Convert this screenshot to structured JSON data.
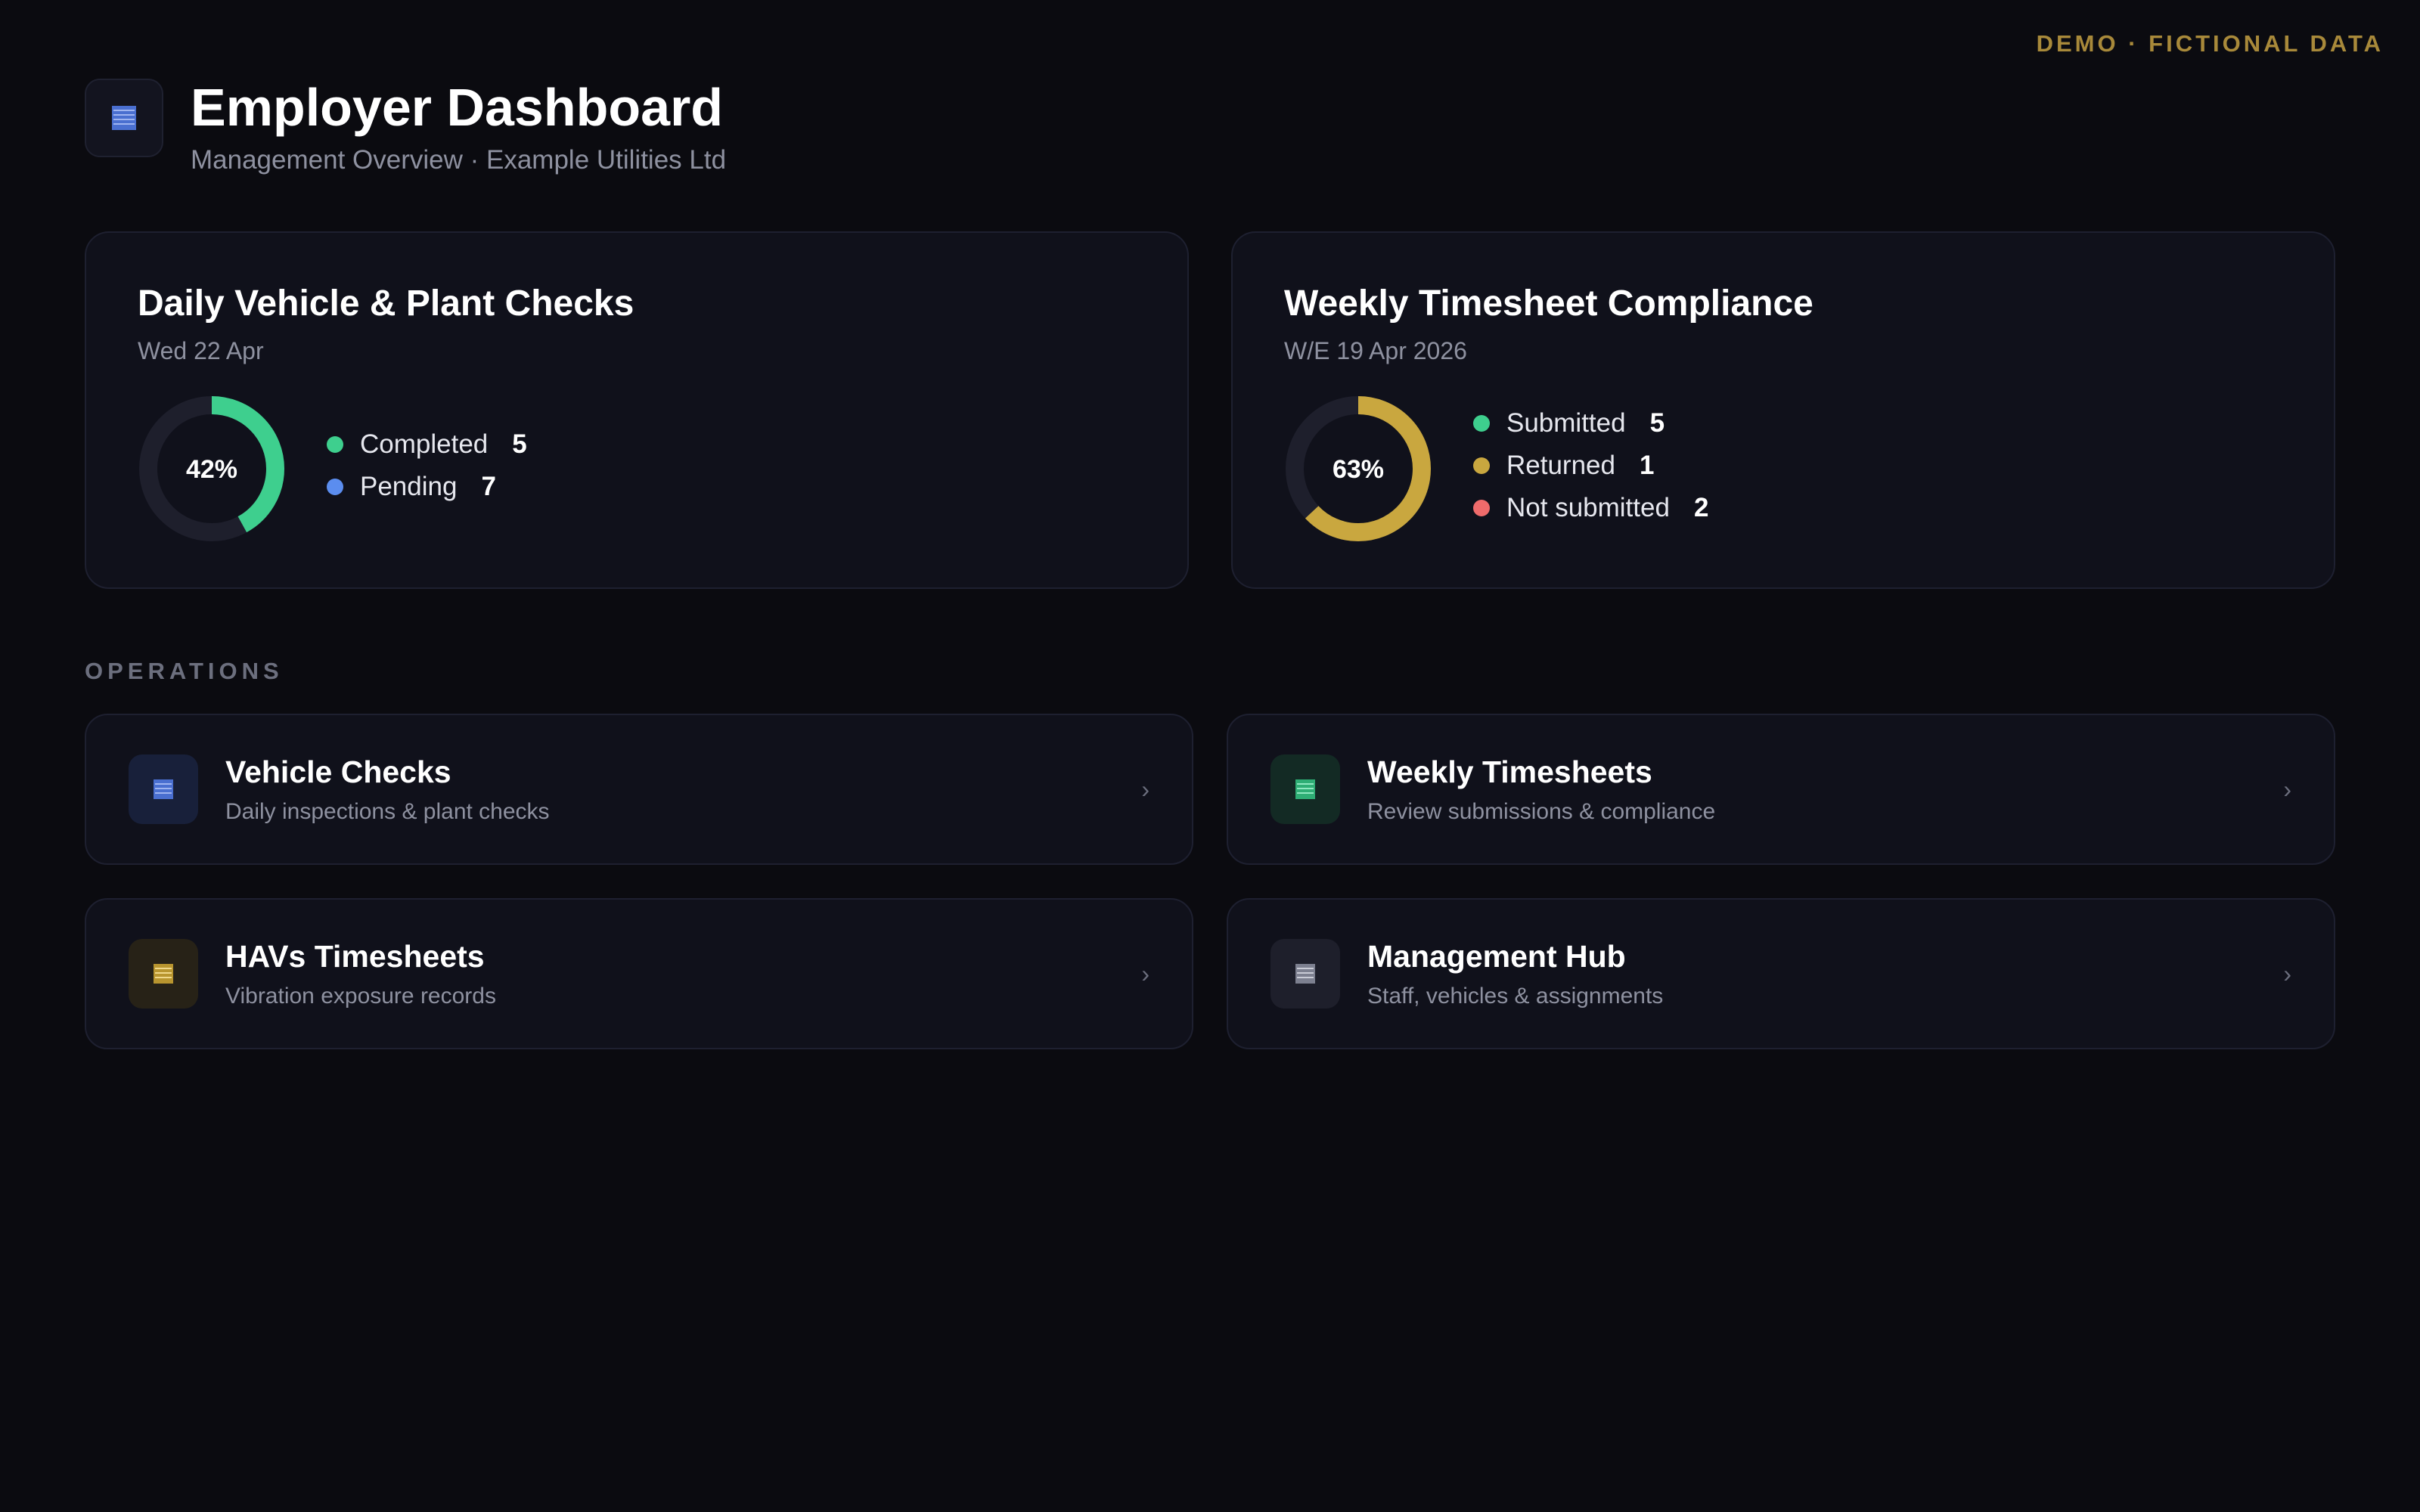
{
  "demo_label": "DEMO · FICTIONAL DATA",
  "header": {
    "title": "Employer Dashboard",
    "subtitle": "Management Overview · Example Utilities Ltd",
    "icon": "document-icon"
  },
  "vehicle_checks_card": {
    "title": "Daily Vehicle & Plant Checks",
    "date": "Wed 22 Apr",
    "percent_label": "42%",
    "percent": 42,
    "legend": [
      {
        "label": "Completed",
        "value": "5",
        "color": "#3ecf8e"
      },
      {
        "label": "Pending",
        "value": "7",
        "color": "#5b8def"
      }
    ]
  },
  "timesheet_card": {
    "title": "Weekly Timesheet Compliance",
    "date": "W/E 19 Apr 2026",
    "percent_label": "63%",
    "percent": 63,
    "legend": [
      {
        "label": "Submitted",
        "value": "5",
        "color": "#3ecf8e"
      },
      {
        "label": "Returned",
        "value": "1",
        "color": "#c9a73f"
      },
      {
        "label": "Not submitted",
        "value": "2",
        "color": "#ef6b6b"
      }
    ]
  },
  "operations": {
    "label": "OPERATIONS",
    "items": [
      {
        "title": "Vehicle Checks",
        "description": "Daily inspections & plant checks",
        "icon": "document-icon",
        "icon_color": "#5b7fd8",
        "icon_bg": "#18203a"
      },
      {
        "title": "Weekly Timesheets",
        "description": "Review submissions & compliance",
        "icon": "document-icon",
        "icon_color": "#3ecf8e",
        "icon_bg": "#132a24"
      },
      {
        "title": "HAVs Timesheets",
        "description": "Vibration exposure records",
        "icon": "document-icon",
        "icon_color": "#c9a73f",
        "icon_bg": "#272217"
      },
      {
        "title": "Management Hub",
        "description": "Staff, vehicles & assignments",
        "icon": "document-icon",
        "icon_color": "#8e91a0",
        "icon_bg": "#1e1f2b"
      }
    ],
    "chevron": "›"
  },
  "colors": {
    "track": "#1e1f2c",
    "check_arc": "#3ecf8e",
    "timesheet_arc": "#c9a73f"
  }
}
